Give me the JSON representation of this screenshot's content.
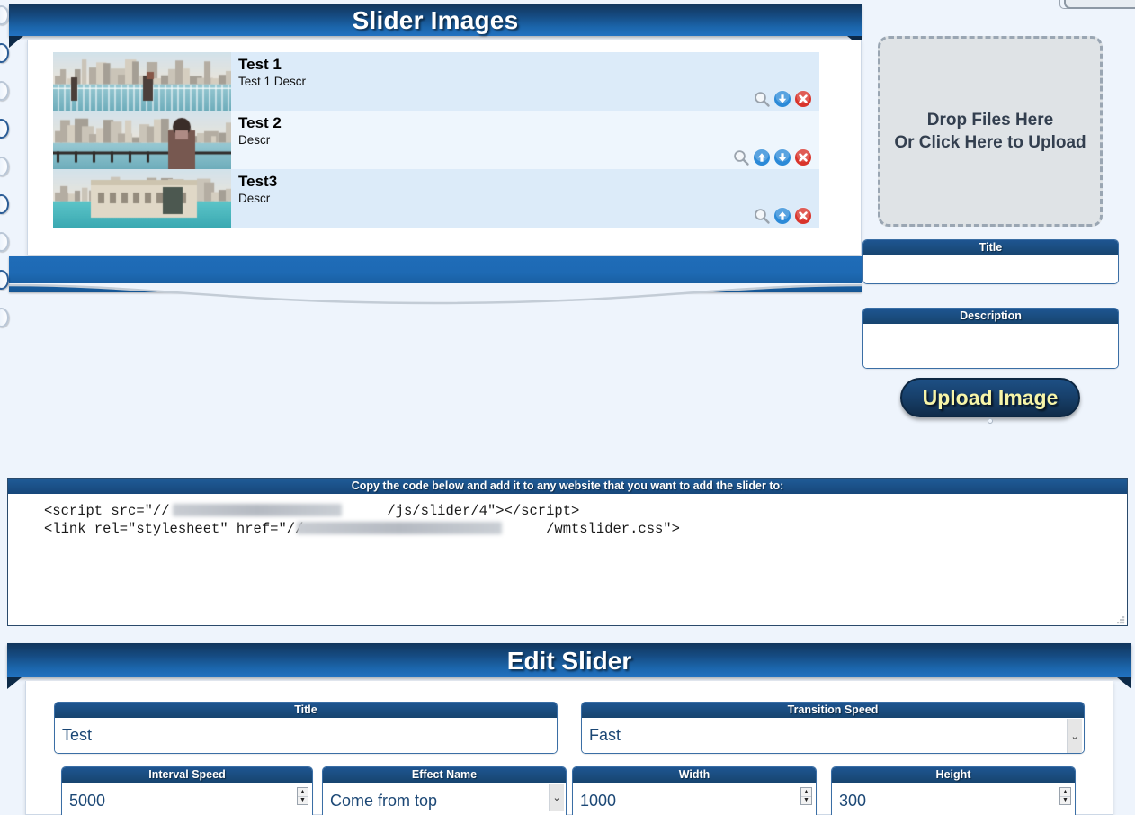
{
  "colors": {
    "ribbon_dark": "#12365d",
    "ribbon_light": "#2272c1",
    "page_bg": "#eef4fc",
    "row_odd": "#dcebf9",
    "row_even": "#eef6fd",
    "button_text": "#f7f5a8",
    "field_border": "#3a6ea5",
    "icon_blue": "#2b8ad8",
    "icon_red": "#d9342b",
    "icon_gray": "#9aa3ad"
  },
  "sections": {
    "slider_images": {
      "title": "Slider Images"
    },
    "edit_slider": {
      "title": "Edit Slider"
    }
  },
  "image_list": {
    "columns": [
      "thumbnail",
      "title",
      "description",
      "actions"
    ],
    "rows": [
      {
        "title": "Test 1",
        "description": "Test 1 Descr",
        "thumb_alt": "waterfront promenade with people at railing",
        "actions": [
          "zoom-icon",
          "move-down-icon",
          "delete-icon"
        ]
      },
      {
        "title": "Test 2",
        "description": "Descr",
        "thumb_alt": "city skyline with person in foreground",
        "actions": [
          "zoom-icon",
          "move-up-icon",
          "move-down-icon",
          "delete-icon"
        ]
      },
      {
        "title": "Test3",
        "description": "Descr",
        "thumb_alt": "waterfront buildings over turquoise water",
        "actions": [
          "zoom-icon",
          "move-up-icon",
          "delete-icon"
        ]
      }
    ]
  },
  "dropzone": {
    "line1": "Drop Files Here",
    "line2": "Or Click Here to Upload"
  },
  "upload_form": {
    "title_label": "Title",
    "title_value": "",
    "description_label": "Description",
    "description_value": "",
    "button_label": "Upload Image"
  },
  "embed_code": {
    "header": "Copy the code below and add it to any website that you want to add the slider to:",
    "content": "<script src=\"//                          /js/slider/4\"></script>\n<link rel=\"stylesheet\" href=\"//                             /wmtslider.css\">"
  },
  "edit_form": {
    "fields": [
      {
        "label": "Title",
        "value": "Test",
        "control": "text"
      },
      {
        "label": "Transition Speed",
        "value": "Fast",
        "control": "select"
      },
      {
        "label": "Interval Speed",
        "value": "5000",
        "control": "number"
      },
      {
        "label": "Effect Name",
        "value": "Come from top",
        "control": "select"
      },
      {
        "label": "Width",
        "value": "1000",
        "control": "number"
      },
      {
        "label": "Height",
        "value": "300",
        "control": "number"
      }
    ]
  },
  "icons": {
    "zoom": "magnifier",
    "move_up": "arrow-up-circle",
    "move_down": "arrow-down-circle",
    "delete": "x-circle",
    "spinner_up": "▲",
    "spinner_down": "▼",
    "select_caret": "⌄"
  }
}
